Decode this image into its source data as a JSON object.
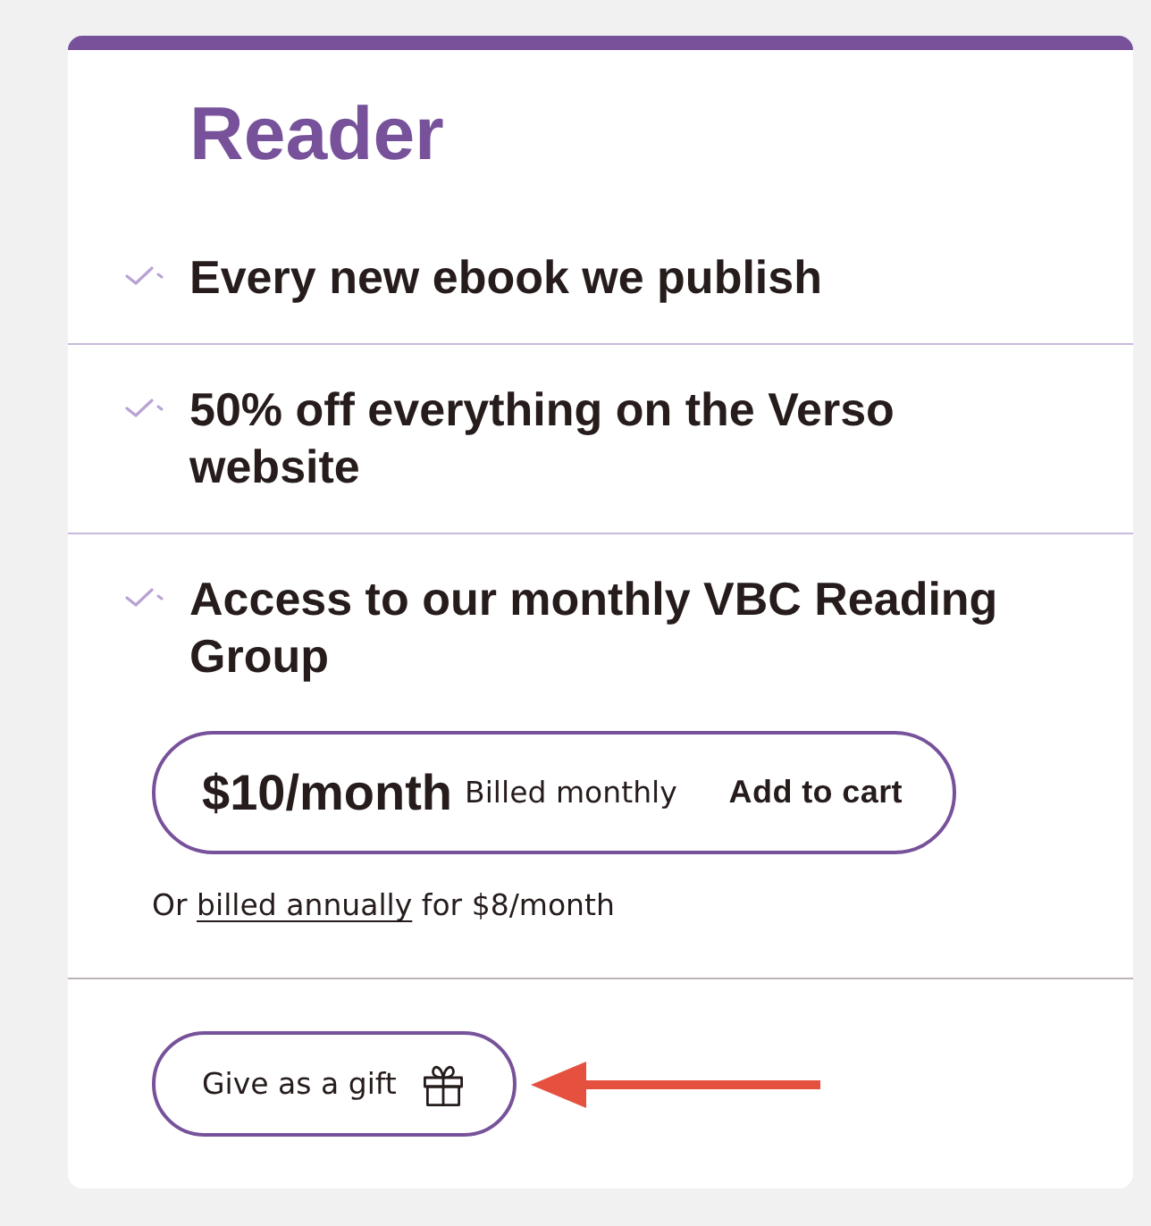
{
  "plan": {
    "title": "Reader"
  },
  "features": [
    "Every new ebook we publish",
    "50% off everything on the Verso website",
    "Access to our monthly VBC Reading Group"
  ],
  "pricing": {
    "price": "$10/month",
    "billing": "Billed monthly",
    "action": "Add to cart"
  },
  "annual_note": {
    "before": "Or",
    "link": "billed annually",
    "after": "for $8/month"
  },
  "gift_button": {
    "label": "Give as a gift"
  }
}
